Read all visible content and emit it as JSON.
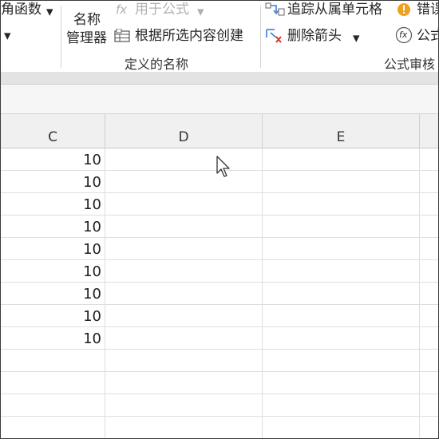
{
  "ribbon": {
    "left_cut_label": "角函数",
    "name_manager_line1": "名称",
    "name_manager_line2": "管理器",
    "use_in_formula": "用于公式",
    "create_from_selection": "根据所选内容创建",
    "defined_names_group": "定义的名称",
    "trace_dependents": "追踪从属单元格",
    "remove_arrows": "删除箭头",
    "error_check_cut": "错误",
    "evaluate_formula_cut": "公式",
    "formula_auditing_group": "公式审核",
    "fx_glyph": "fx"
  },
  "columns": [
    {
      "label": "C"
    },
    {
      "label": "D"
    },
    {
      "label": "E"
    }
  ],
  "rows": [
    {
      "c": "10"
    },
    {
      "c": "10"
    },
    {
      "c": "10"
    },
    {
      "c": "10"
    },
    {
      "c": "10"
    },
    {
      "c": "10"
    },
    {
      "c": "10"
    },
    {
      "c": "10"
    },
    {
      "c": "10"
    },
    {
      "c": ""
    },
    {
      "c": ""
    },
    {
      "c": ""
    },
    {
      "c": ""
    }
  ],
  "colors": {
    "warning": "#f0a020",
    "arrow_blue": "#3a7bd5",
    "remove_red": "#d9342b"
  }
}
